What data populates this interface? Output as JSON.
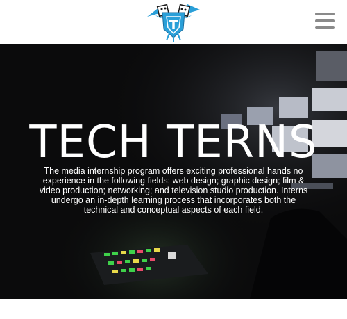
{
  "header": {
    "logo_icon": "tech-terns-bird-logo-icon",
    "logo_text": "T",
    "menu_icon": "hamburger-menu-icon"
  },
  "hero": {
    "title": "TECH TERNS",
    "description": "The media internship program offers exciting professional hands no experience in the following fields: web design; graphic design; film & video production; networking; and television studio production. Interns undergo an in-depth learning process that incorporates both the technical and conceptual aspects of each field."
  },
  "colors": {
    "logo_blue": "#2a9fd8",
    "hero_background": "#0b0b0c",
    "menu_gray": "#8a8a8a"
  }
}
